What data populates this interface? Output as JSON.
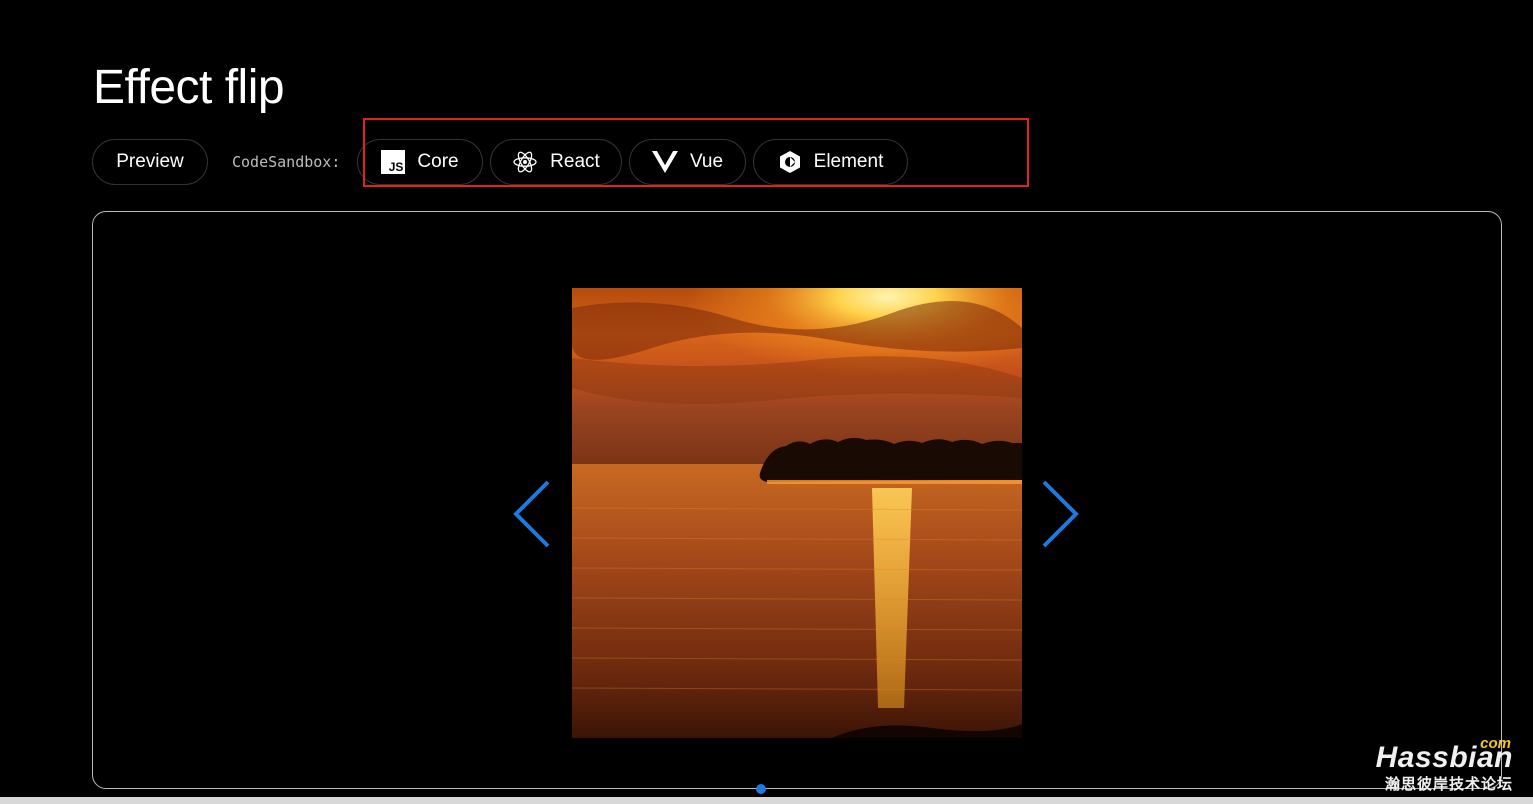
{
  "page": {
    "title": "Effect flip"
  },
  "toolbar": {
    "preview_label": "Preview",
    "codesandbox_label": "CodeSandbox:",
    "buttons": [
      {
        "label": "Core",
        "icon": "js-icon"
      },
      {
        "label": "React",
        "icon": "react-icon"
      },
      {
        "label": "Vue",
        "icon": "vue-icon"
      },
      {
        "label": "Element",
        "icon": "element-icon"
      }
    ]
  },
  "annotation": {
    "color": "#e0231e"
  },
  "slider": {
    "image": "sunset-over-lake",
    "nav_color": "#1f7ae0",
    "prev_icon": "chevron-left-icon",
    "next_icon": "chevron-right-icon"
  },
  "watermark": {
    "com": "com",
    "brand": "Hassbian",
    "subtitle": "瀚思彼岸技术论坛"
  }
}
